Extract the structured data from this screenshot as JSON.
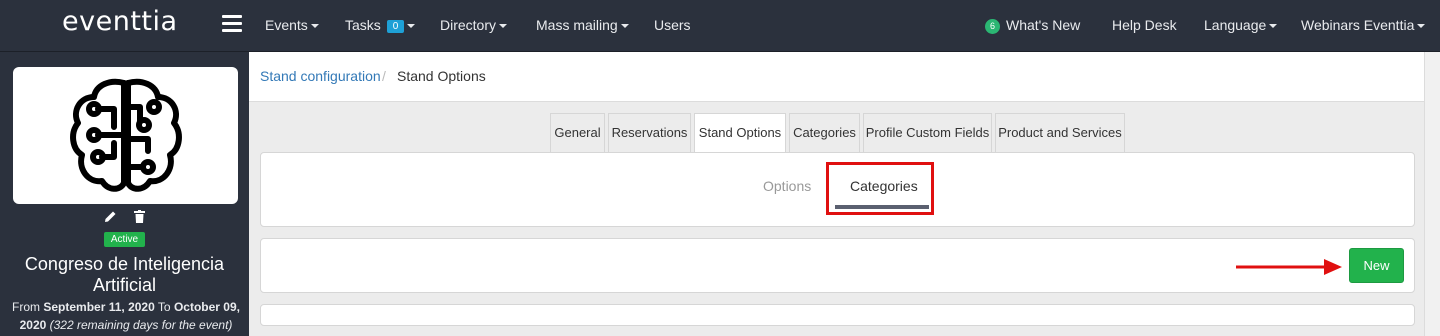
{
  "brand": {
    "logo": "eventtia"
  },
  "navbar": {
    "menu_icon": "hamburger-menu-icon",
    "items": [
      {
        "label": "Events",
        "dropdown": true
      },
      {
        "label": "Tasks",
        "badge": "0",
        "dropdown": true
      },
      {
        "label": "Directory",
        "dropdown": true
      },
      {
        "label": "Mass mailing",
        "dropdown": true
      },
      {
        "label": "Users",
        "dropdown": false
      }
    ],
    "right": {
      "whats_new_badge": "6",
      "whats_new_label": "What's New",
      "help_desk": "Help Desk",
      "language": "Language",
      "account": "Webinars Eventtia"
    }
  },
  "sidebar": {
    "event_image_icon": "brain-circuit-icon",
    "edit_icon": "pencil-icon",
    "delete_icon": "trash-icon",
    "status": "Active",
    "event_title": "Congreso de Inteligencia Artificial",
    "dates": {
      "from_label": "From",
      "start": "September 11, 2020",
      "to_label": "To",
      "end": "October 09, 2020",
      "remaining": "(322 remaining days for the event)"
    }
  },
  "breadcrumb": {
    "parent": "Stand configuration",
    "separator": "/",
    "current": "Stand Options"
  },
  "tabs": [
    {
      "label": "General",
      "active": false
    },
    {
      "label": "Reservations",
      "active": false
    },
    {
      "label": "Stand Options",
      "active": true
    },
    {
      "label": "Categories",
      "active": false
    },
    {
      "label": "Profile Custom Fields",
      "active": false
    },
    {
      "label": "Product and Services",
      "active": false
    }
  ],
  "subtabs": {
    "options": "Options",
    "categories": "Categories",
    "active": "Categories"
  },
  "actions": {
    "new_button": "New"
  },
  "colors": {
    "navbar_bg": "#2b313d",
    "link": "#3379b7",
    "success": "#22b24c",
    "annotation_red": "#e01010",
    "badge_blue": "#1ea0d6"
  }
}
